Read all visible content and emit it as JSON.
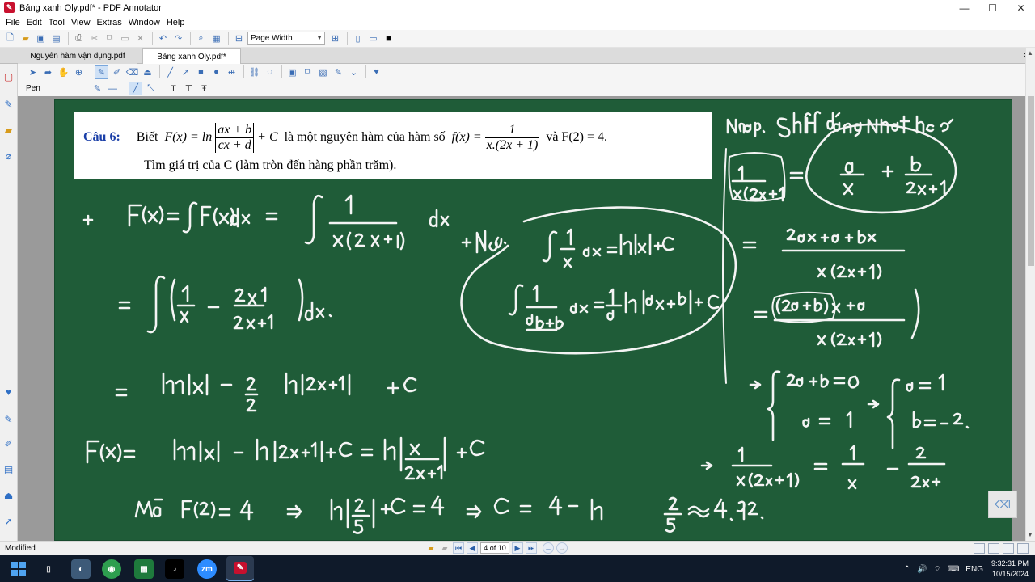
{
  "window": {
    "title": "Bảng xanh Oly.pdf* - PDF Annotator",
    "app_icon": "pdf-annotator-icon",
    "controls": [
      "minimize",
      "maximize",
      "close"
    ]
  },
  "menu": [
    "File",
    "Edit",
    "Tool",
    "View",
    "Extras",
    "Window",
    "Help"
  ],
  "toolbar": {
    "zoom_value": "Page Width"
  },
  "tabs": [
    {
      "label": "Nguyên hàm vận dụng.pdf",
      "active": false
    },
    {
      "label": "Bảng xanh Oly.pdf*",
      "active": true
    }
  ],
  "annotation_toolbar": {
    "tool_label": "Pen"
  },
  "document": {
    "question": {
      "label": "Câu 6:",
      "line1_pre": "Biết",
      "func_F": "F(x) = ln",
      "abs_num": "ax + b",
      "abs_den": "cx + d",
      "plusC": "+ C",
      "middle": "là một nguyên hàm của hàm số",
      "func_f": "f(x) =",
      "f_num": "1",
      "f_den": "x.(2x + 1)",
      "tail": "và F(2) = 4.",
      "line2": "Tìm giá trị của C (làm tròn đến hàng phần trăm)."
    },
    "handwriting_note": "Handwritten solution in white ink on green board background",
    "board_color": "#1f5c38"
  },
  "status": {
    "text": "Modified",
    "page_indicator": "4 of 10"
  },
  "taskbar": {
    "apps": [
      "windows-start",
      "phone-app",
      "browser",
      "chrome",
      "sheets",
      "tiktok",
      "zoom",
      "pdf-annotator"
    ],
    "language": "ENG",
    "time": "9:32:31 PM",
    "date": "10/15/2024"
  }
}
